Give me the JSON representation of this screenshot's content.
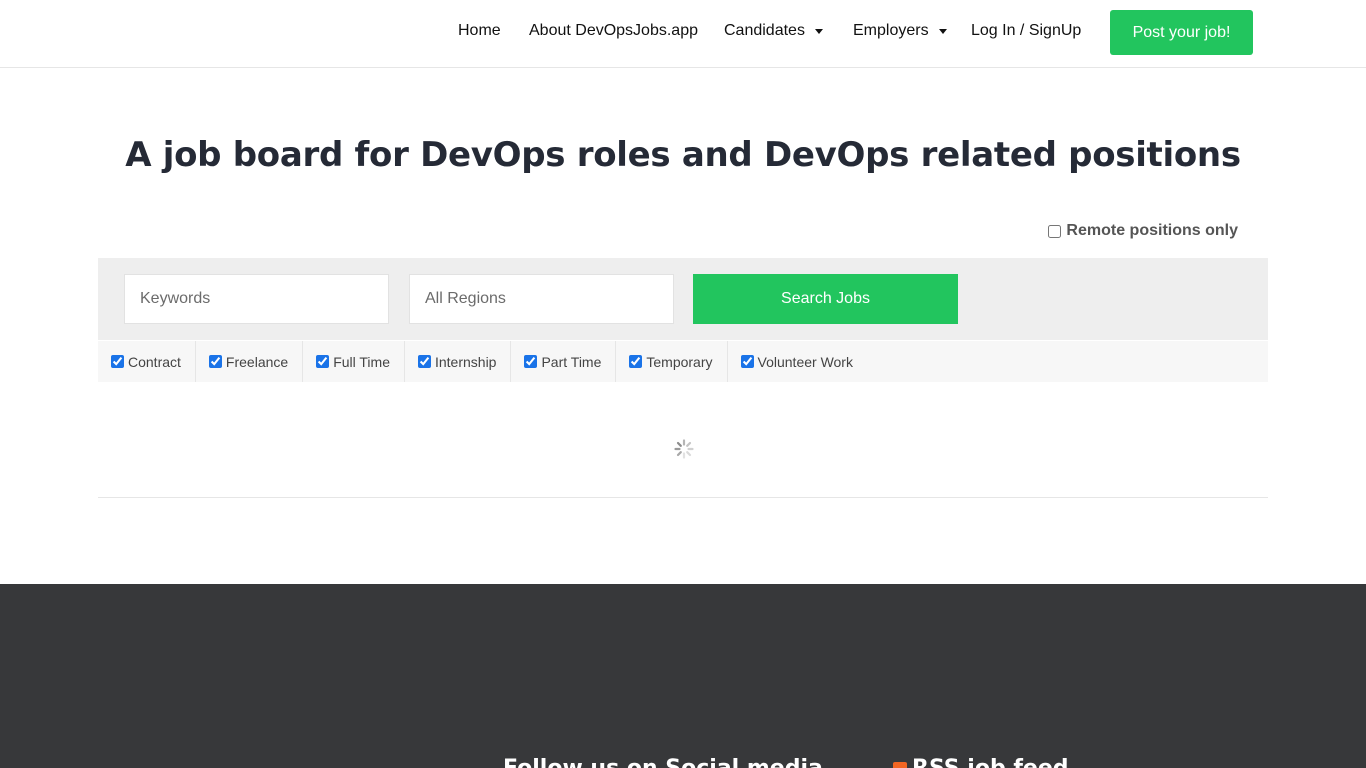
{
  "nav": {
    "home": "Home",
    "about": "About DevOpsJobs.app",
    "candidates": "Candidates",
    "employers": "Employers",
    "login": "Log In / SignUp",
    "post_job": "Post your job!"
  },
  "hero": {
    "title": "A job board for DevOps roles and DevOps related positions"
  },
  "search": {
    "remote_label": "Remote positions only",
    "keywords_placeholder": "Keywords",
    "regions_placeholder": "All Regions",
    "search_button": "Search Jobs"
  },
  "job_types": [
    {
      "label": "Contract",
      "checked": true
    },
    {
      "label": "Freelance",
      "checked": true
    },
    {
      "label": "Full Time",
      "checked": true
    },
    {
      "label": "Internship",
      "checked": true
    },
    {
      "label": "Part Time",
      "checked": true
    },
    {
      "label": "Temporary",
      "checked": true
    },
    {
      "label": "Volunteer Work",
      "checked": true
    }
  ],
  "footer": {
    "social_heading": "Follow us on Social media",
    "rss_heading": "RSS job feed"
  },
  "colors": {
    "accent": "#22c55e",
    "footer_bg": "#37383a",
    "title": "#252a36"
  },
  "icons": {
    "loading": "loading-spinner-icon",
    "rss": "rss-icon",
    "dropdown": "chevron-down-icon"
  }
}
